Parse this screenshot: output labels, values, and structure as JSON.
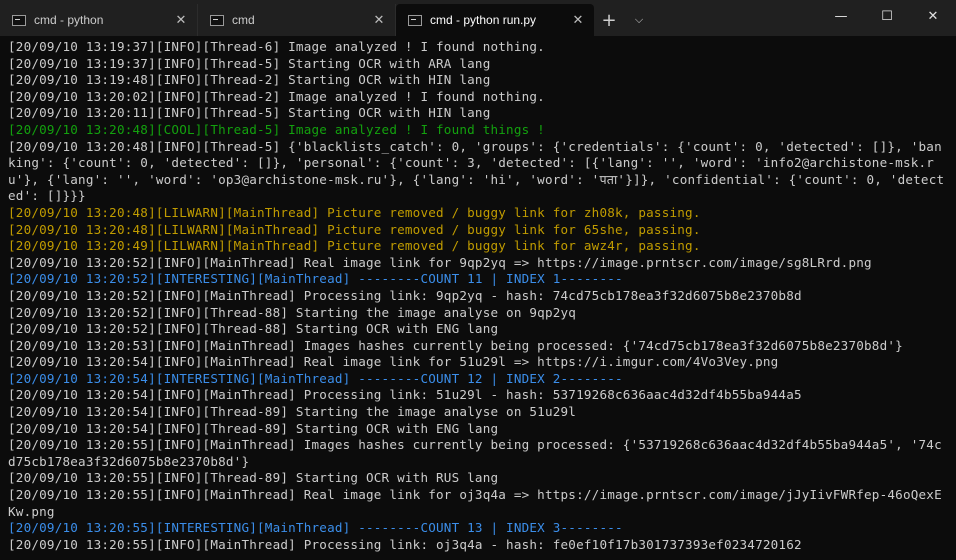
{
  "tabs": [
    {
      "title": "cmd - python",
      "active": false
    },
    {
      "title": "cmd",
      "active": false
    },
    {
      "title": "cmd - python  run.py",
      "active": true
    }
  ],
  "window_controls": {
    "minimize": "—",
    "maximize": "☐",
    "close": "✕"
  },
  "tab_controls": {
    "new_tab": "+",
    "dropdown": "⌵",
    "close": "✕"
  },
  "colors": {
    "default": "#cccccc",
    "cool": "#13a10e",
    "lilwarn": "#c19c00",
    "interesting": "#3b8eea",
    "background": "#0c0c0c"
  },
  "console": {
    "lines": [
      {
        "level": "info",
        "text": "[20/09/10 13:19:37][INFO][Thread-6] Image analyzed ! I found nothing."
      },
      {
        "level": "info",
        "text": "[20/09/10 13:19:37][INFO][Thread-5] Starting OCR with ARA lang"
      },
      {
        "level": "info",
        "text": "[20/09/10 13:19:48][INFO][Thread-2] Starting OCR with HIN lang"
      },
      {
        "level": "info",
        "text": "[20/09/10 13:20:02][INFO][Thread-2] Image analyzed ! I found nothing."
      },
      {
        "level": "info",
        "text": "[20/09/10 13:20:11][INFO][Thread-5] Starting OCR with HIN lang"
      },
      {
        "level": "cool",
        "text": "[20/09/10 13:20:48][COOL][Thread-5] Image analyzed ! I found things !"
      },
      {
        "level": "info",
        "text": "[20/09/10 13:20:48][INFO][Thread-5] {'blacklists_catch': 0, 'groups': {'credentials': {'count': 0, 'detected': []}, 'banking': {'count': 0, 'detected': []}, 'personal': {'count': 3, 'detected': [{'lang': '', 'word': 'info2@archistone-msk.ru'}, {'lang': '', 'word': 'op3@archistone-msk.ru'}, {'lang': 'hi', 'word': 'पता'}]}, 'confidential': {'count': 0, 'detected': []}}}"
      },
      {
        "level": "lilwarn",
        "text": "[20/09/10 13:20:48][LILWARN][MainThread] Picture removed / buggy link for zh08k, passing."
      },
      {
        "level": "lilwarn",
        "text": "[20/09/10 13:20:48][LILWARN][MainThread] Picture removed / buggy link for 65she, passing."
      },
      {
        "level": "lilwarn",
        "text": "[20/09/10 13:20:49][LILWARN][MainThread] Picture removed / buggy link for awz4r, passing."
      },
      {
        "level": "info",
        "text": "[20/09/10 13:20:52][INFO][MainThread] Real image link for 9qp2yq => https://image.prntscr.com/image/sg8LRrd.png"
      },
      {
        "level": "interesting",
        "text": "[20/09/10 13:20:52][INTERESTING][MainThread] --------COUNT 11 | INDEX 1--------"
      },
      {
        "level": "info",
        "text": "[20/09/10 13:20:52][INFO][MainThread] Processing link: 9qp2yq - hash: 74cd75cb178ea3f32d6075b8e2370b8d"
      },
      {
        "level": "info",
        "text": "[20/09/10 13:20:52][INFO][Thread-88] Starting the image analyse on 9qp2yq"
      },
      {
        "level": "info",
        "text": "[20/09/10 13:20:52][INFO][Thread-88] Starting OCR with ENG lang"
      },
      {
        "level": "info",
        "text": "[20/09/10 13:20:53][INFO][MainThread] Images hashes currently being processed: {'74cd75cb178ea3f32d6075b8e2370b8d'}"
      },
      {
        "level": "info",
        "text": "[20/09/10 13:20:54][INFO][MainThread] Real image link for 51u29l => https://i.imgur.com/4Vo3Vey.png"
      },
      {
        "level": "interesting",
        "text": "[20/09/10 13:20:54][INTERESTING][MainThread] --------COUNT 12 | INDEX 2--------"
      },
      {
        "level": "info",
        "text": "[20/09/10 13:20:54][INFO][MainThread] Processing link: 51u29l - hash: 53719268c636aac4d32df4b55ba944a5"
      },
      {
        "level": "info",
        "text": "[20/09/10 13:20:54][INFO][Thread-89] Starting the image analyse on 51u29l"
      },
      {
        "level": "info",
        "text": "[20/09/10 13:20:54][INFO][Thread-89] Starting OCR with ENG lang"
      },
      {
        "level": "info",
        "text": "[20/09/10 13:20:55][INFO][MainThread] Images hashes currently being processed: {'53719268c636aac4d32df4b55ba944a5', '74cd75cb178ea3f32d6075b8e2370b8d'}"
      },
      {
        "level": "info",
        "text": "[20/09/10 13:20:55][INFO][Thread-89] Starting OCR with RUS lang"
      },
      {
        "level": "info",
        "text": "[20/09/10 13:20:55][INFO][MainThread] Real image link for oj3q4a => https://image.prntscr.com/image/jJyIivFWRfep-46oQexEKw.png"
      },
      {
        "level": "interesting",
        "text": "[20/09/10 13:20:55][INTERESTING][MainThread] --------COUNT 13 | INDEX 3--------"
      },
      {
        "level": "info",
        "text": "[20/09/10 13:20:55][INFO][MainThread] Processing link: oj3q4a - hash: fe0ef10f17b301737393ef0234720162"
      }
    ]
  }
}
